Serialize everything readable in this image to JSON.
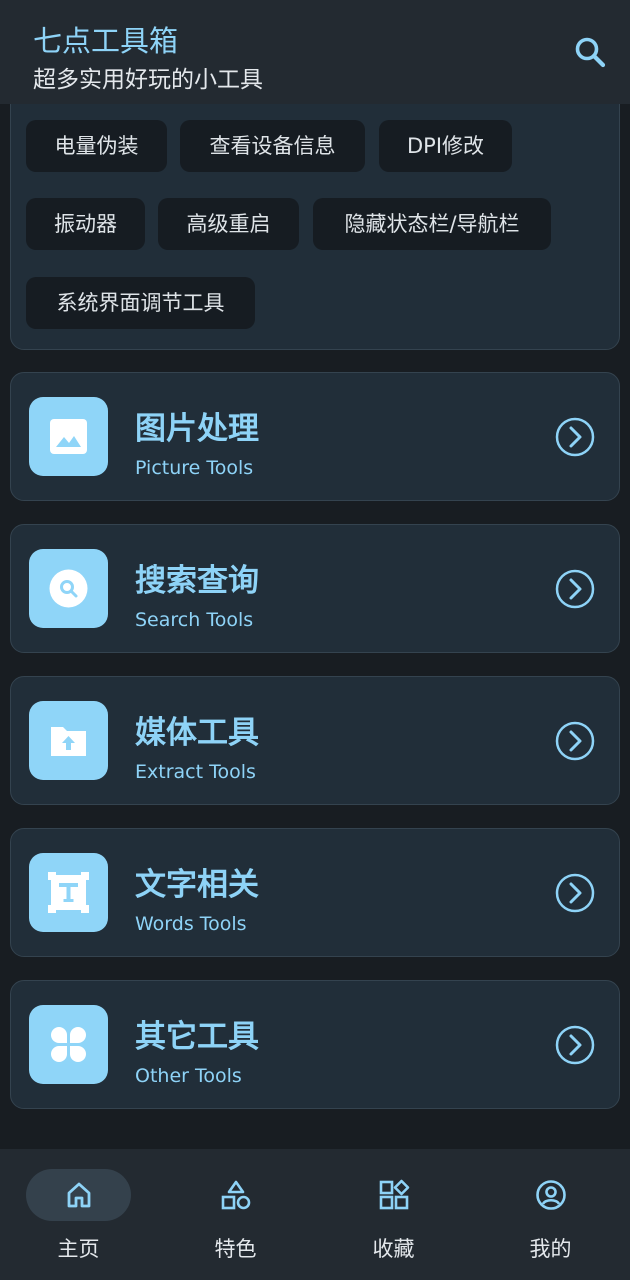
{
  "app": {
    "title": "七点工具箱",
    "subtitle": "超多实用好玩的小工具"
  },
  "header_icons": {
    "search": "search-icon"
  },
  "chips": [
    {
      "label": "电量伪装"
    },
    {
      "label": "查看设备信息"
    },
    {
      "label": "DPI修改"
    },
    {
      "label": "振动器"
    },
    {
      "label": "高级重启"
    },
    {
      "label": "隐藏状态栏/导航栏"
    },
    {
      "label": "系统界面调节工具"
    }
  ],
  "categories": [
    {
      "title": "图片处理",
      "subtitle": "Picture Tools",
      "icon": "image-icon"
    },
    {
      "title": "搜索查询",
      "subtitle": "Search Tools",
      "icon": "search-icon"
    },
    {
      "title": "媒体工具",
      "subtitle": "Extract Tools",
      "icon": "folder-upload-icon"
    },
    {
      "title": "文字相关",
      "subtitle": "Words Tools",
      "icon": "text-icon"
    },
    {
      "title": "其它工具",
      "subtitle": "Other Tools",
      "icon": "grid-icon"
    }
  ],
  "nav": [
    {
      "label": "主页",
      "icon": "home-icon",
      "active": true
    },
    {
      "label": "特色",
      "icon": "shapes-icon",
      "active": false
    },
    {
      "label": "收藏",
      "icon": "apps-icon",
      "active": false
    },
    {
      "label": "我的",
      "icon": "account-icon",
      "active": false
    }
  ],
  "colors": {
    "accent": "#8ed3f7",
    "background": "#181d22",
    "card": "#212e39",
    "bar": "#232a31",
    "chip": "#161c22"
  }
}
